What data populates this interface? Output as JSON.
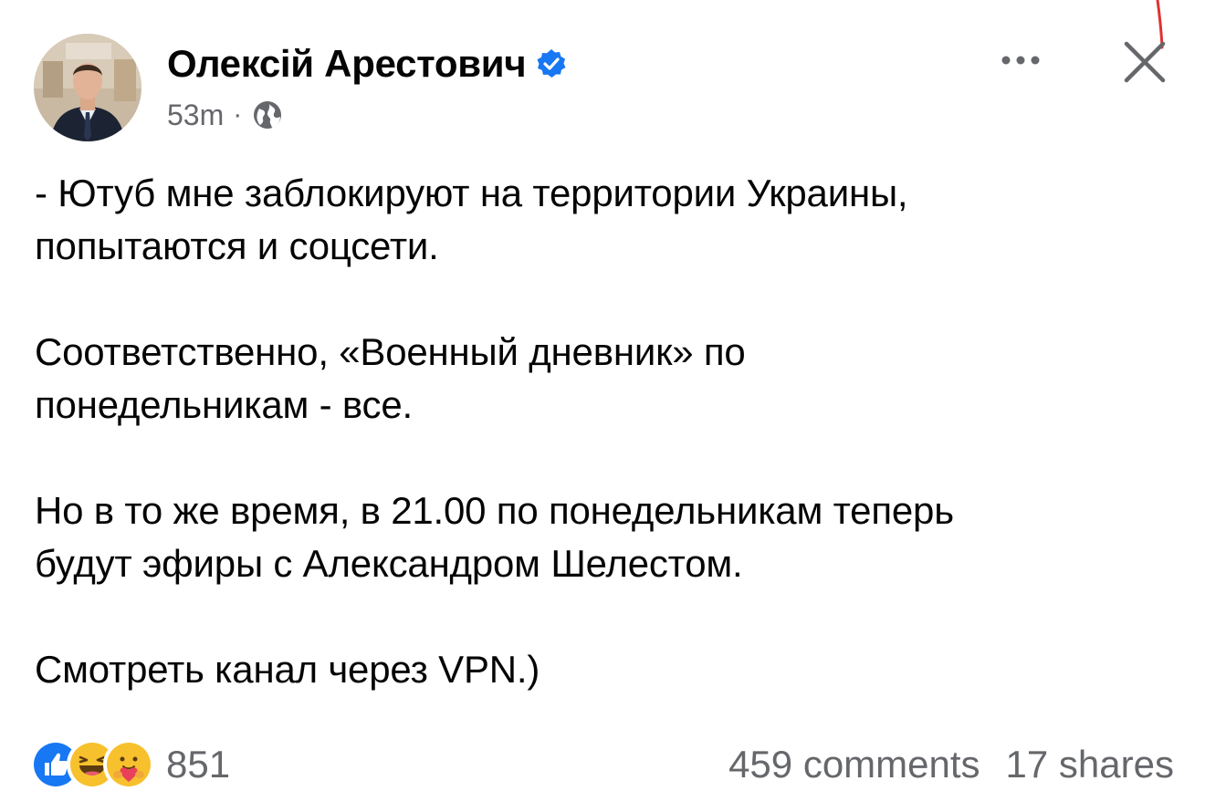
{
  "post": {
    "author": {
      "name": "Олексій Арестович",
      "verified": true,
      "avatar_icon": "profile-photo"
    },
    "timestamp": "53m",
    "meta_separator": "·",
    "audience_icon": "globe-icon",
    "paragraphs": [
      "- Ютуб мне заблокируют на территории Украины,\nпопытаются и соцсети.",
      "Соответственно, «Военный дневник» по\nпонедельникам - все.",
      "Но в то же время, в 21.00 по понедельникам теперь\nбудут эфиры с Александром Шелестом.",
      "Смотреть канал через VPN.)"
    ],
    "reactions": {
      "icons": [
        "like-icon",
        "haha-icon",
        "care-icon"
      ],
      "count": "851"
    },
    "comments": "459 comments",
    "shares": "17 shares"
  },
  "colors": {
    "text_primary": "#050505",
    "text_secondary": "#65676b",
    "verified_blue": "#1877f2",
    "like_blue": "#1877f2",
    "emoji_yellow": "#f7c02d"
  }
}
